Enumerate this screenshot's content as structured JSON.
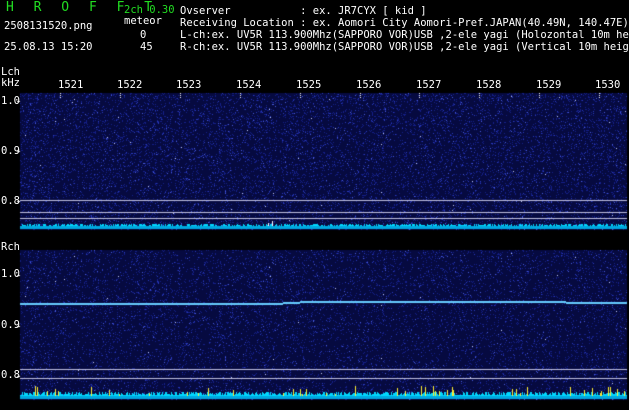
{
  "header": {
    "app_name": "H R O F F T",
    "version": "2ch 0.30",
    "filename": "2508131520.png",
    "datetime": "25.08.13 15:20",
    "meteor_label": "meteor",
    "meteor_lch": "0",
    "meteor_rch": "45",
    "observer": "Ovserver           : ex. JR7CYX [ kid ]",
    "location": "Receiving Location : ex. Aomori City Aomori-Pref.JAPAN(40.49N, 140.47E)",
    "lch_info": "L-ch:ex. UV5R 113.900Mhz(SAPPORO VOR)USB ,2-ele yagi (Holozontal 10m height)",
    "rch_info": "R-ch:ex. UV5R 113.900Mhz(SAPPORO VOR)USB ,2-ele yagi (Vertical 10m height)"
  },
  "time_axis": {
    "ticks": [
      "1521",
      "1522",
      "1523",
      "1524",
      "1525",
      "1526",
      "1527",
      "1528",
      "1529",
      "1530"
    ]
  },
  "lch": {
    "label": "Lch",
    "unit": "kHz",
    "freq_ticks": [
      "1.0",
      "0.9",
      "0.8"
    ]
  },
  "rch": {
    "label": "Rch",
    "freq_ticks": [
      "1.0",
      "0.9",
      "0.8"
    ]
  },
  "colors": {
    "background": "#000000",
    "noise": "#1a2aa0",
    "trace": "#66ccff",
    "baseline": "#00d8ff",
    "meteor_bar": "#ffee33",
    "title": "#22dd22"
  }
}
